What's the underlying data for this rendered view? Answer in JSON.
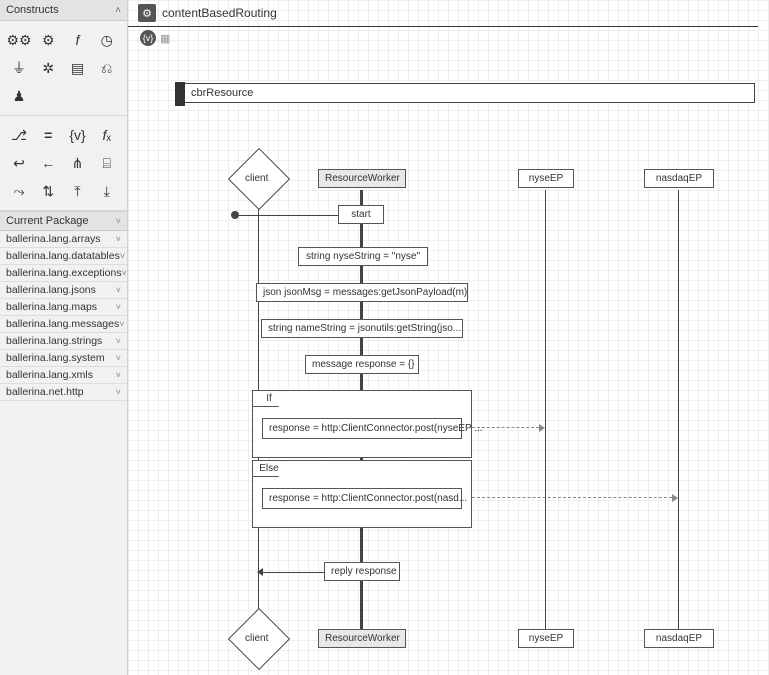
{
  "sidebar": {
    "title": "Constructs",
    "tool_grid_1": [
      "gears-icon",
      "gear-icon",
      "function-icon",
      "clock-icon",
      "plug-icon",
      "gear2-icon",
      "storage-icon",
      "s-icon",
      "worker-icon"
    ],
    "tool_grid_2": [
      "branch-icon",
      "equals-icon",
      "var-icon",
      "fx-icon",
      "return-icon",
      "arrow-left-icon",
      "fork-icon",
      "bracket-icon",
      "s2-icon",
      "transform-icon",
      "action1-icon",
      "action2-icon"
    ],
    "packages_header": "Current Package",
    "packages": [
      "ballerina.lang.arrays",
      "ballerina.lang.datatables",
      "ballerina.lang.exceptions",
      "ballerina.lang.jsons",
      "ballerina.lang.maps",
      "ballerina.lang.messages",
      "ballerina.lang.strings",
      "ballerina.lang.system",
      "ballerina.lang.xmls",
      "ballerina.net.http"
    ]
  },
  "diagram": {
    "service_name": "contentBasedRouting",
    "var_badge": "{v}",
    "resource_name": "cbrResource",
    "client_label": "client",
    "worker_label": "ResourceWorker",
    "nyse_label": "nyseEP",
    "nasdaq_label": "nasdaqEP",
    "start_label": "start",
    "stmt1": "string nyseString = \"nyse\"",
    "stmt2": "json jsonMsg = messages:getJsonPayload(m)",
    "stmt3": "string nameString = jsonutils:getString(jso...",
    "stmt4": "message response = {}",
    "if_label": "If",
    "if_body": "response = http:ClientConnector.post(nyseEP ...",
    "else_label": "Else",
    "else_body": "response = http:ClientConnector.post(nasd...",
    "reply_label": "reply response"
  },
  "chart_data": {
    "type": "sequence-diagram",
    "service": "contentBasedRouting",
    "resource": "cbrResource",
    "lifelines": [
      "client",
      "ResourceWorker",
      "nyseEP",
      "nasdaqEP"
    ],
    "statements": [
      {
        "type": "start",
        "label": "start",
        "from": "client",
        "to": "ResourceWorker"
      },
      {
        "type": "assign",
        "text": "string nyseString = \"nyse\""
      },
      {
        "type": "assign",
        "text": "json jsonMsg = messages:getJsonPayload(m)"
      },
      {
        "type": "assign",
        "text": "string nameString = jsonutils:getString(jso...)"
      },
      {
        "type": "assign",
        "text": "message response = {}"
      },
      {
        "type": "if",
        "branches": [
          {
            "label": "If",
            "body": "response = http:ClientConnector.post(nyseEP ...)",
            "connector_call_to": "nyseEP"
          },
          {
            "label": "Else",
            "body": "response = http:ClientConnector.post(nasd...)",
            "connector_call_to": "nasdaqEP"
          }
        ]
      },
      {
        "type": "reply",
        "label": "reply response",
        "to": "client"
      }
    ]
  }
}
